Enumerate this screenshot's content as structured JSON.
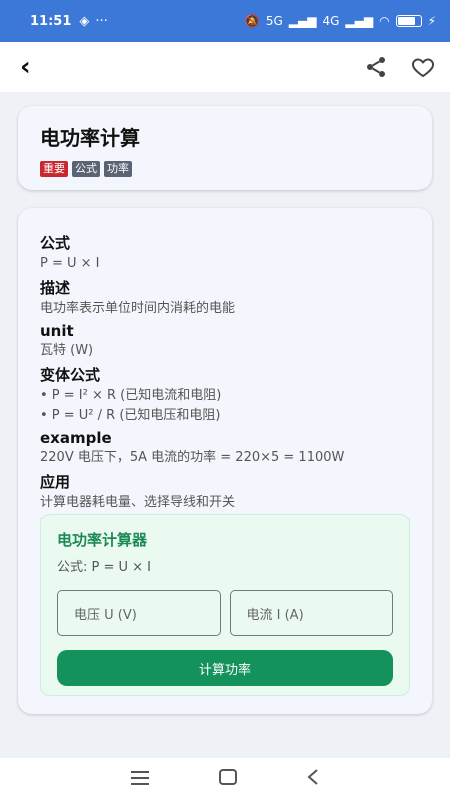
{
  "status_bar": {
    "time": "11:51",
    "extra": "···",
    "signal_1": "5G",
    "signal_2": "4G",
    "battery_level": 0.8
  },
  "app_bar": {
    "back_label": "‹",
    "icons": [
      "share-icon",
      "heart-icon"
    ]
  },
  "title_card": {
    "title": "电功率计算",
    "tags": [
      {
        "label": "重要",
        "color": "#c8282e"
      },
      {
        "label": "公式",
        "color": "#5a6472"
      },
      {
        "label": "功率",
        "color": "#5a6472"
      }
    ]
  },
  "details": {
    "formula_title": "公式",
    "formula_value": "P = U × I",
    "description_title": "描述",
    "description_value": "电功率表示单位时间内消耗的电能",
    "unit_title": "unit",
    "unit_value": "瓦特 (W)",
    "variants_title": "变体公式",
    "variant_1": "• P = I² × R (已知电流和电阻)",
    "variant_2": "• P = U² / R (已知电压和电阻)",
    "example_title": "example",
    "example_value": "220V 电压下，5A 电流的功率 = 220×5 = 1100W",
    "application_title": "应用",
    "application_value": "计算电器耗电量、选择导线和开关"
  },
  "calculator": {
    "title": "电功率计算器",
    "formula": "公式: P = U × I",
    "voltage_placeholder": "电压 U (V)",
    "current_placeholder": "电流 I (A)",
    "button_label": "计算功率"
  },
  "colors": {
    "accent_blue": "#3b78d8",
    "accent_green": "#14925c"
  }
}
